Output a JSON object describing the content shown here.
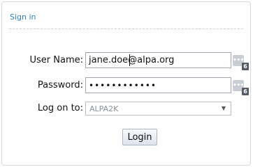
{
  "panel": {
    "title": "Sign in"
  },
  "form": {
    "username_label": "User Name:",
    "username_value": "jane.doe@alpa.org",
    "password_label": "Password:",
    "password_value": "••••••••••••",
    "logon_label": "Log on to:",
    "logon_selected": "ALPA2K",
    "login_label": "Login"
  },
  "password_manager": {
    "button_glyph": "•••",
    "badge_count": "6",
    "icon": "password-manager-icon"
  },
  "colors": {
    "title": "#2f7fc1",
    "border": "#d3d8de"
  }
}
